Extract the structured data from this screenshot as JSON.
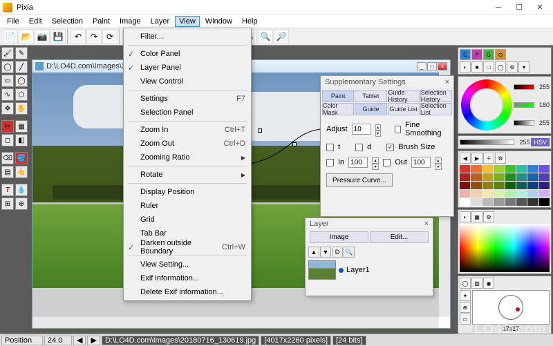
{
  "app": {
    "title": "Pixia"
  },
  "menubar": [
    "File",
    "Edit",
    "Selection",
    "Paint",
    "Image",
    "Layer",
    "View",
    "Window",
    "Help"
  ],
  "activeMenu": "View",
  "viewMenu": {
    "items": [
      {
        "label": "Filter...",
        "type": "item"
      },
      {
        "type": "sep"
      },
      {
        "label": "Color Panel",
        "type": "item",
        "checked": true
      },
      {
        "label": "Layer Panel",
        "type": "item",
        "checked": true
      },
      {
        "label": "View Control",
        "type": "item"
      },
      {
        "type": "sep"
      },
      {
        "label": "Settings",
        "type": "item",
        "shortcut": "F7",
        "arrow": true
      },
      {
        "label": "Selection Panel",
        "type": "item"
      },
      {
        "type": "sep"
      },
      {
        "label": "Zoom In",
        "type": "item",
        "shortcut": "Ctrl+T"
      },
      {
        "label": "Zoom Out",
        "type": "item",
        "shortcut": "Ctrl+D"
      },
      {
        "label": "Zooming Ratio",
        "type": "item",
        "arrow": true
      },
      {
        "type": "sep"
      },
      {
        "label": "Rotate",
        "type": "item",
        "arrow": true
      },
      {
        "type": "sep"
      },
      {
        "label": "Display Position",
        "type": "item"
      },
      {
        "label": "Ruler",
        "type": "item"
      },
      {
        "label": "Grid",
        "type": "item"
      },
      {
        "label": "Tab Bar",
        "type": "item"
      },
      {
        "label": "Darken outside Boundary",
        "type": "item",
        "checked": true,
        "shortcut": "Ctrl+W"
      },
      {
        "type": "sep"
      },
      {
        "label": "View Setting...",
        "type": "item"
      },
      {
        "label": "Exif information...",
        "type": "item"
      },
      {
        "label": "Delete Exif information...",
        "type": "item"
      }
    ]
  },
  "document": {
    "title": "D:\\LO4D.com\\Images\\20180716_130619.jpg"
  },
  "supp": {
    "title": "Supplementary Settings",
    "tabsTop": [
      "Paint",
      "Tablet",
      "Guide History",
      "Selection History"
    ],
    "tabsBottom": [
      "Color Mask",
      "Guide",
      "Guide List",
      "Selection List"
    ],
    "adjust_label": "Adjust",
    "adjust_value": "10",
    "fine_smoothing": "Fine Smoothing",
    "t": "t",
    "d": "d",
    "brush_size": "Brush Size",
    "in_label": "In",
    "in_value": "100",
    "out_label": "Out",
    "out_value": "100",
    "pressure_btn": "Pressure Curve..."
  },
  "layer": {
    "title": "Layer",
    "image_btn": "Image",
    "edit_btn": "Edit...",
    "layer_name": "Layer1"
  },
  "color": {
    "hue_label": "255",
    "sat_label": "180",
    "val_label": "255",
    "gray_label": "255",
    "mode": "HSV",
    "brush_size": "17x17"
  },
  "status": {
    "pos_label": "Position",
    "zoom": "24.0",
    "file": "D:\\LO4D.com\\Images\\20180716_130619.jpg",
    "dims": "[4017x2260 pixels]",
    "bits": "[24 bits]"
  },
  "palette_colors": [
    "#e03030",
    "#f07030",
    "#f0c030",
    "#a0d030",
    "#40c030",
    "#30c0a0",
    "#3080e0",
    "#7050e0",
    "#b02020",
    "#c06020",
    "#c0a020",
    "#80b020",
    "#209020",
    "#209080",
    "#2060b0",
    "#5040b0",
    "#801010",
    "#905010",
    "#908010",
    "#608010",
    "#106010",
    "#106050",
    "#104080",
    "#302080",
    "#f0b0b0",
    "#f0d0b0",
    "#f0e8b0",
    "#d8f0b0",
    "#b0f0b0",
    "#b0f0d8",
    "#b0d0f0",
    "#d0b0f0",
    "#ffffff",
    "#dddddd",
    "#bbbbbb",
    "#999999",
    "#777777",
    "#555555",
    "#333333",
    "#000000"
  ],
  "watermark": "LO4D.com"
}
